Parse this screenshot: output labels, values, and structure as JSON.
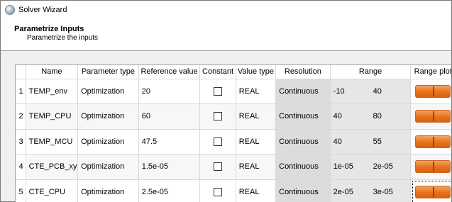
{
  "window": {
    "title": "Solver Wizard"
  },
  "header": {
    "title": "Parametrize Inputs",
    "subtitle": "Parametrize the inputs"
  },
  "table": {
    "columns": [
      "",
      "Name",
      "Parameter type",
      "Reference value",
      "Constant",
      "Value type",
      "Resolution",
      "Range",
      "Range plot"
    ],
    "rows": [
      {
        "index": "1",
        "name": "TEMP_env",
        "ptype": "Optimization",
        "ref": "20",
        "constant": false,
        "vtype": "REAL",
        "resolution": "Continuous",
        "min": "-10",
        "max": "40"
      },
      {
        "index": "2",
        "name": "TEMP_CPU",
        "ptype": "Optimization",
        "ref": "60",
        "constant": false,
        "vtype": "REAL",
        "resolution": "Continuous",
        "min": "40",
        "max": "80"
      },
      {
        "index": "3",
        "name": "TEMP_MCU",
        "ptype": "Optimization",
        "ref": "47.5",
        "constant": false,
        "vtype": "REAL",
        "resolution": "Continuous",
        "min": "40",
        "max": "55"
      },
      {
        "index": "4",
        "name": "CTE_PCB_xy",
        "ptype": "Optimization",
        "ref": "1.5e-05",
        "constant": false,
        "vtype": "REAL",
        "resolution": "Continuous",
        "min": "1e-05",
        "max": "2e-05"
      },
      {
        "index": "5",
        "name": "CTE_CPU",
        "ptype": "Optimization",
        "ref": "2.5e-05",
        "constant": false,
        "vtype": "REAL",
        "resolution": "Continuous",
        "min": "2e-05",
        "max": "3e-05"
      }
    ]
  },
  "colors": {
    "range_plot": "#e8711c",
    "resolution_bg": "#dcdcdc"
  },
  "icons": {
    "app": "solver-globe-icon"
  }
}
